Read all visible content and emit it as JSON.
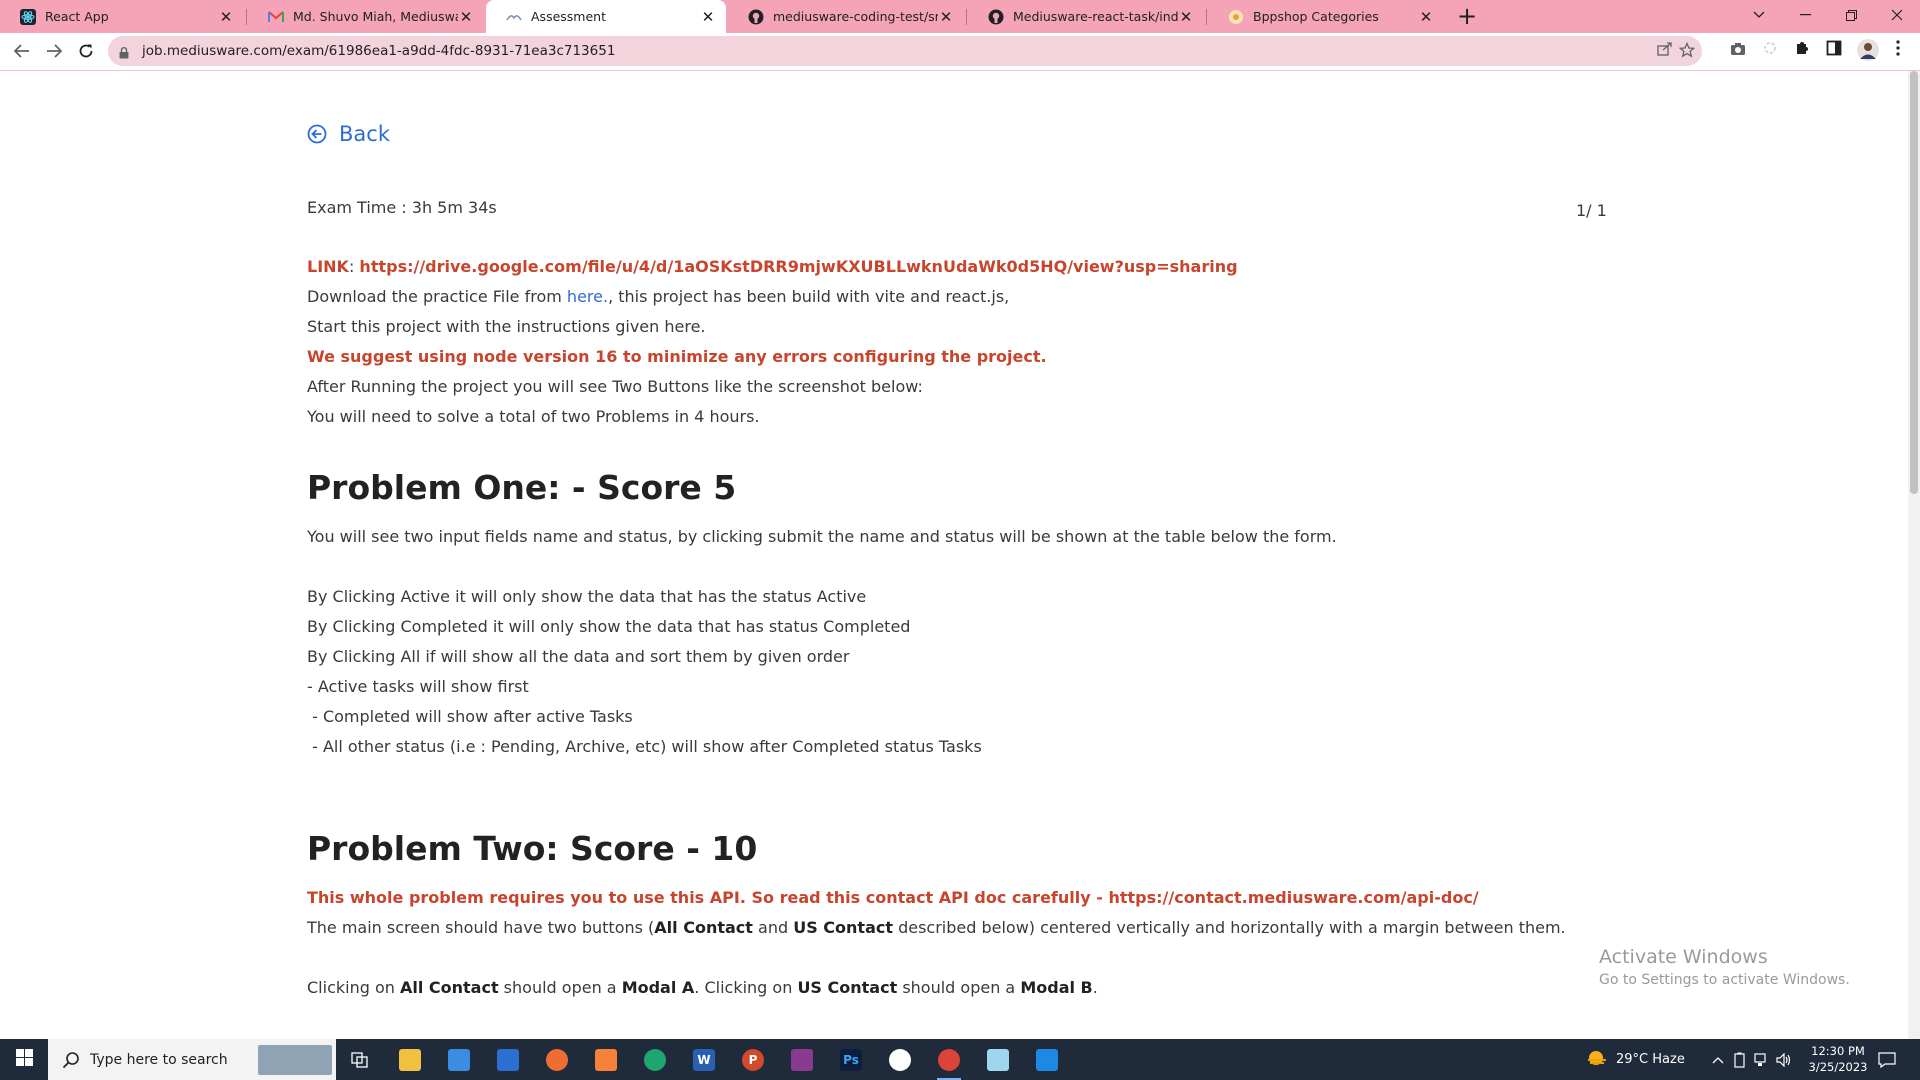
{
  "browser": {
    "tabs": [
      {
        "label": "React App",
        "icon": "react-icon",
        "color": "#61dafb"
      },
      {
        "label": "Md. Shuvo Miah, Mediusware Job",
        "icon": "gmail-icon",
        "color": "#ea4335"
      },
      {
        "label": "Assessment",
        "icon": "mediusware-icon",
        "color": "#7a8fb3"
      },
      {
        "label": "mediusware-coding-test/src at de",
        "icon": "github-icon",
        "color": "#202124"
      },
      {
        "label": "Mediusware-react-task/index.htm",
        "icon": "github-icon",
        "color": "#202124"
      },
      {
        "label": "Bppshop Categories",
        "icon": "bppshop-icon",
        "color": "#e8a23a"
      }
    ],
    "url": "job.mediusware.com/exam/61986ea1-a9dd-4fdc-8931-71ea3c713651"
  },
  "page": {
    "back_label": "Back",
    "exam_time": "Exam Time : 3h 5m 34s",
    "pager": "1/ 1",
    "link_label": "LINK",
    "link_sep": ": ",
    "link_url": "https://drive.google.com/file/u/4/d/1aOSKstDRR9mjwKXUBLLwknUdaWk0d5HQ/view?usp=sharing",
    "download_pre": "Download the practice File from ",
    "download_link": "here.",
    "download_post": ", this project has been build with vite and react.js,",
    "start_line": "Start this project with the instructions given here.",
    "node_warning": "We suggest using node version 16 to minimize any errors configuring the project.",
    "after_running": "After Running the project you will see Two Buttons like the screenshot below:",
    "solve_line": "You will need to solve a total of two Problems in 4 hours.",
    "problem_one_title": "Problem One: - Score 5",
    "p1_intro": "You will see two input fields name and status, by clicking submit the name and status will be shown at the table below the form.",
    "p1_lines": [
      "By Clicking Active it will only show the data that has the status Active",
      "By Clicking Completed it will only show the data that has status Completed",
      "By Clicking All if will show all the data and sort them by given order",
      "- Active tasks will show first",
      " - Completed will show after active Tasks",
      " - All other status (i.e : Pending, Archive, etc) will show after Completed status Tasks"
    ],
    "problem_two_title": "Problem Two: Score - 10",
    "p2_api": "This whole problem requires you to use this API. So read this contact API doc carefully - https://contact.mediusware.com/api-doc/",
    "p2_main_pre": "The main screen should have two buttons (",
    "p2_all_contact": "All Contact",
    "p2_and": " and ",
    "p2_us_contact": "US Contact",
    "p2_main_post": " described below) centered vertically and horizontally with a margin between them.",
    "p2_click_pre": "Clicking on ",
    "p2_click_mid1": " should open a ",
    "p2_modal_a": "Modal A",
    "p2_click_mid2": ". Clicking on ",
    "p2_modal_b": "Modal B",
    "p2_click_end": "."
  },
  "watermark": {
    "title": "Activate Windows",
    "subtitle": "Go to Settings to activate Windows."
  },
  "taskbar": {
    "search_placeholder": "Type here to search",
    "weather": "29°C  Haze",
    "time": "12:30 PM",
    "date": "3/25/2023"
  },
  "colors": {
    "tabstrip": "#f5a3b7",
    "link_red": "#c8452d",
    "link_blue": "#2f6bd6",
    "taskbar": "#1f2a3a"
  }
}
